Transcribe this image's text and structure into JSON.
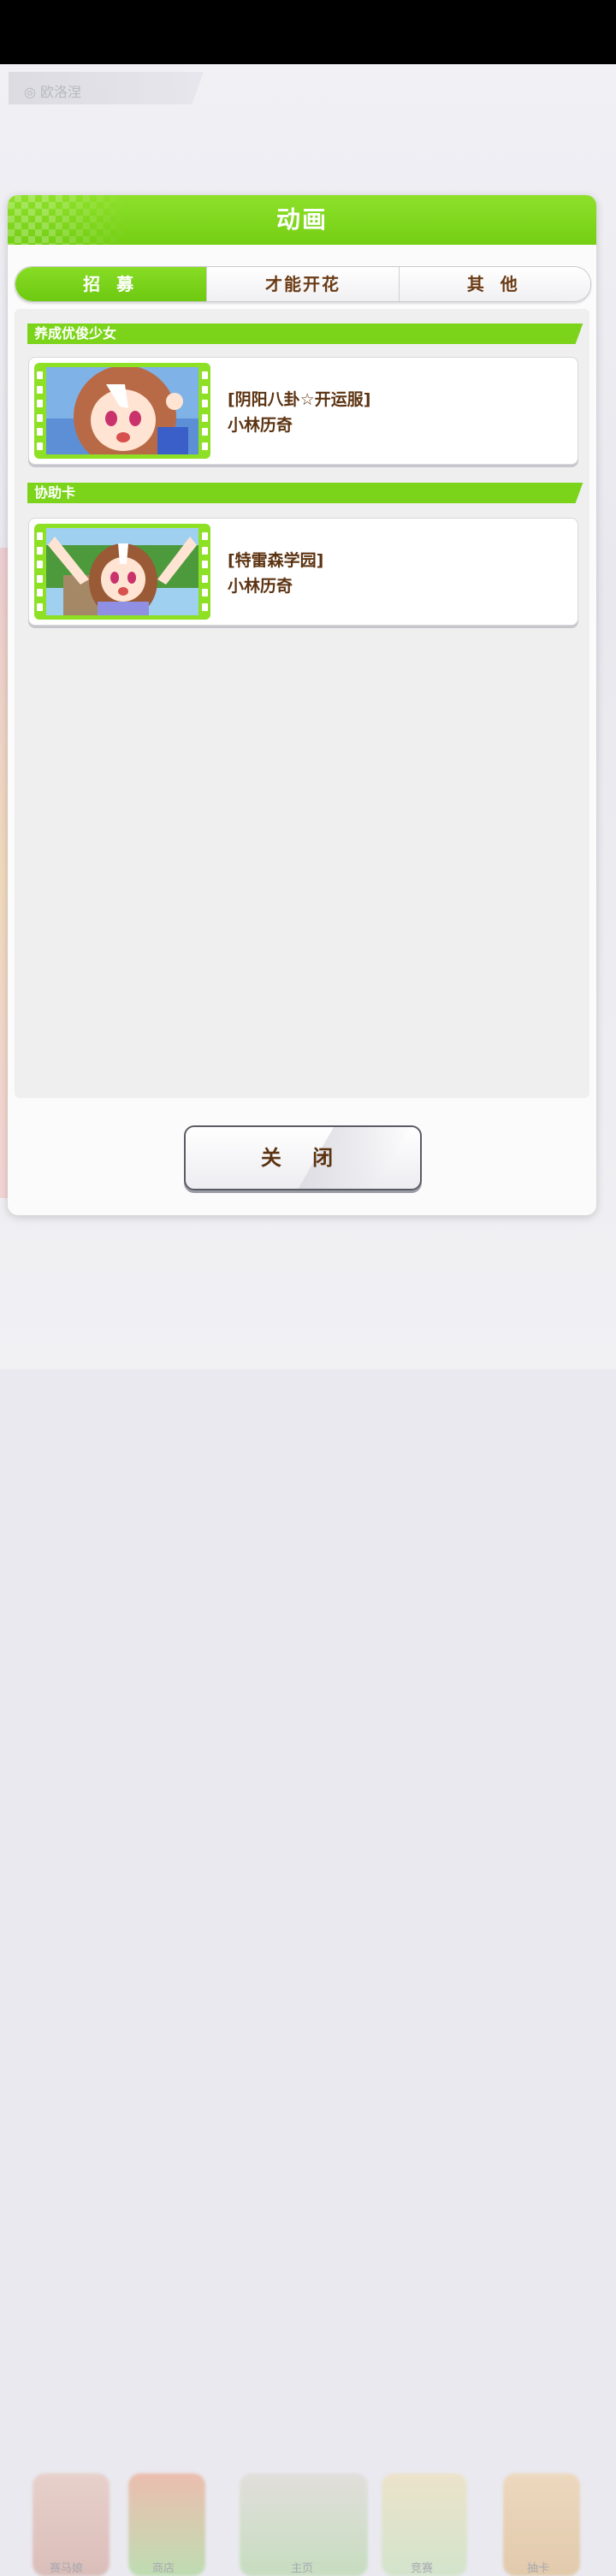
{
  "background": {
    "tab_label": "◎ 欧洛涅"
  },
  "dialog": {
    "title": "动画",
    "tabs": [
      {
        "label": "招 募",
        "active": true
      },
      {
        "label": "才能开花",
        "active": false
      },
      {
        "label": "其 他",
        "active": false
      }
    ],
    "sections": [
      {
        "header": "养成优俊少女",
        "items": [
          {
            "title": "[阴阳八卦☆开运服]",
            "subtitle": "小林历奇"
          }
        ]
      },
      {
        "header": "协助卡",
        "items": [
          {
            "title": "[特雷森学园]",
            "subtitle": "小林历奇"
          }
        ]
      }
    ],
    "close_label": "关 闭"
  },
  "bottom_nav": {
    "items": [
      "赛马娘",
      "商店",
      "主页",
      "竞赛",
      "抽卡"
    ]
  },
  "colors": {
    "accent_green": "#7bd41a",
    "text_brown": "#5c3311"
  }
}
